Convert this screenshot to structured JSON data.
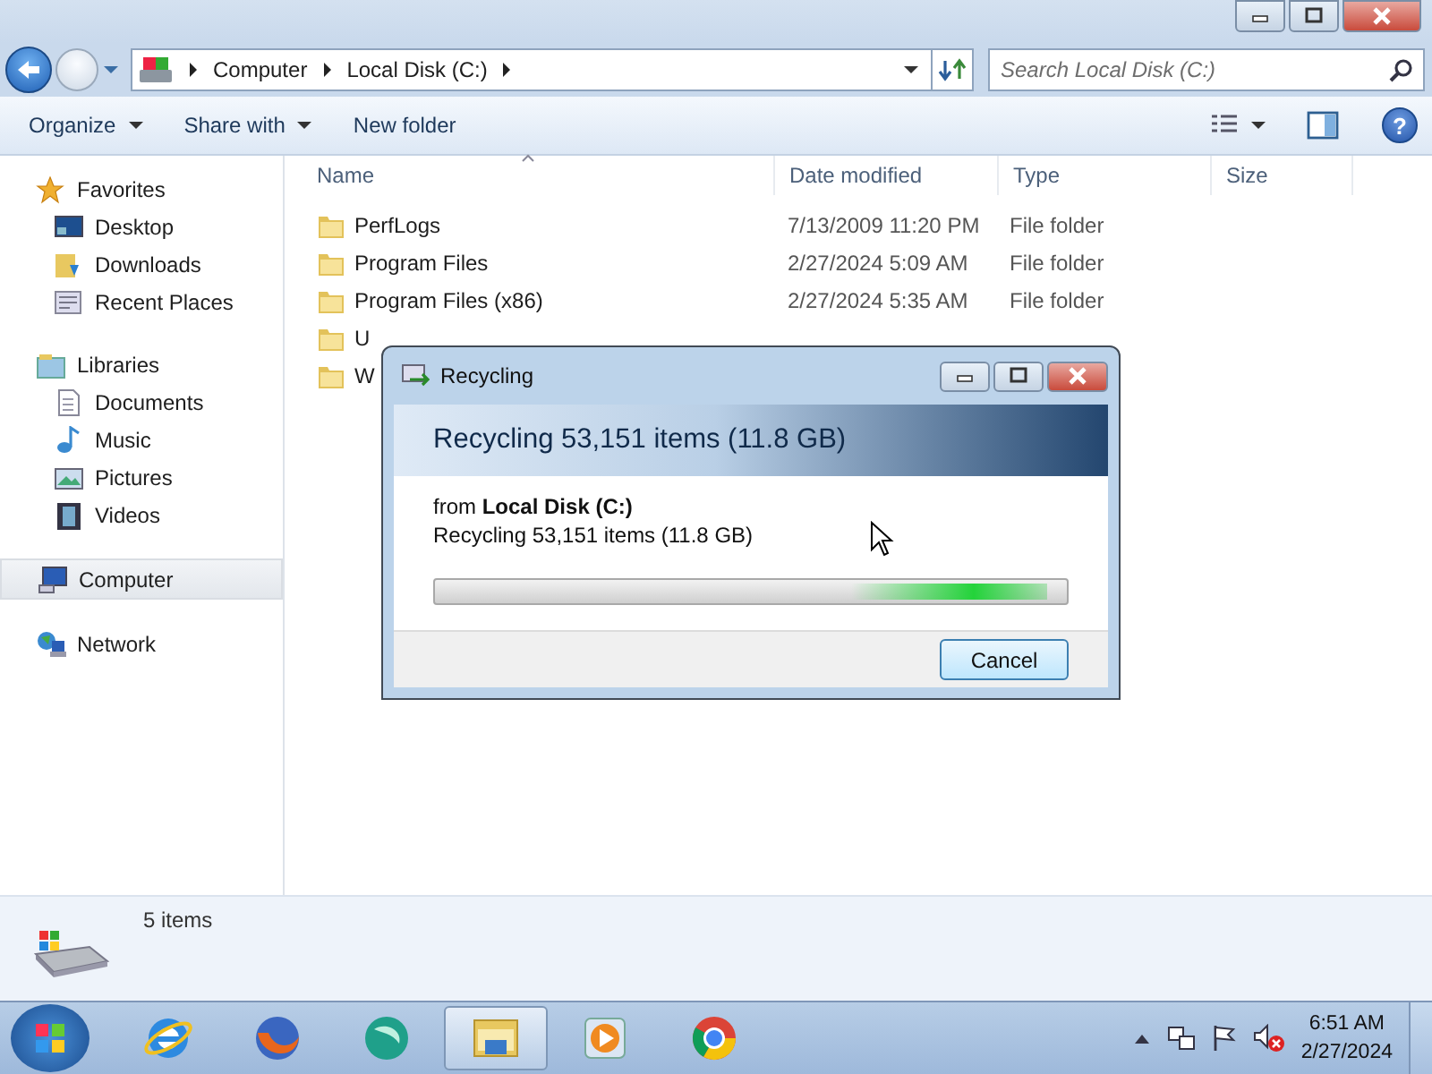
{
  "window": {
    "address": [
      "Computer",
      "Local Disk (C:)"
    ],
    "search": {
      "placeholder": "Search Local Disk (C:)"
    }
  },
  "toolbar": {
    "items": [
      "Organize",
      "Share with",
      "New folder"
    ],
    "help": "?"
  },
  "sidebar": {
    "groups": [
      {
        "label": "Favorites",
        "selected": false,
        "children": [
          {
            "label": "Desktop",
            "selected": false
          },
          {
            "label": "Downloads",
            "selected": false
          },
          {
            "label": "Recent Places",
            "selected": false
          }
        ]
      },
      {
        "label": "Libraries",
        "selected": false,
        "children": [
          {
            "label": "Documents",
            "selected": false
          },
          {
            "label": "Music",
            "selected": false
          },
          {
            "label": "Pictures",
            "selected": false
          },
          {
            "label": "Videos",
            "selected": false
          }
        ]
      },
      {
        "label": "Computer",
        "selected": true
      },
      {
        "label": "Network",
        "selected": false
      }
    ]
  },
  "table": {
    "columns": [
      "Name",
      "Date modified",
      "Type",
      "Size"
    ],
    "rows": [
      {
        "name": "PerfLogs",
        "date": "7/13/2009 11:20 PM",
        "type": "File folder"
      },
      {
        "name": "Program Files",
        "date": "2/27/2024 5:09 AM",
        "type": "File folder"
      },
      {
        "name": "Program Files (x86)",
        "date": "2/27/2024 5:35 AM",
        "type": "File folder"
      },
      {
        "name": "U"
      },
      {
        "name": "W"
      }
    ]
  },
  "status_bar": {
    "text": "5 items"
  },
  "dialog": {
    "title": "Recycling",
    "heading": "Recycling 53,151 items (11.8 GB)",
    "from": "from **Local Disk (C:)**",
    "detail": "Recycling 53,151 items (11.8 GB)",
    "progress": {
      "level": 0.97
    },
    "button": "Cancel"
  },
  "taskbar": {
    "apps": [
      {
        "selected": false
      },
      {
        "selected": false
      },
      {
        "selected": false
      },
      {
        "selected": true
      },
      {
        "selected": false
      },
      {
        "selected": false
      }
    ],
    "clock": {
      "time": "6:51 AM",
      "date": "2/27/2024"
    }
  }
}
